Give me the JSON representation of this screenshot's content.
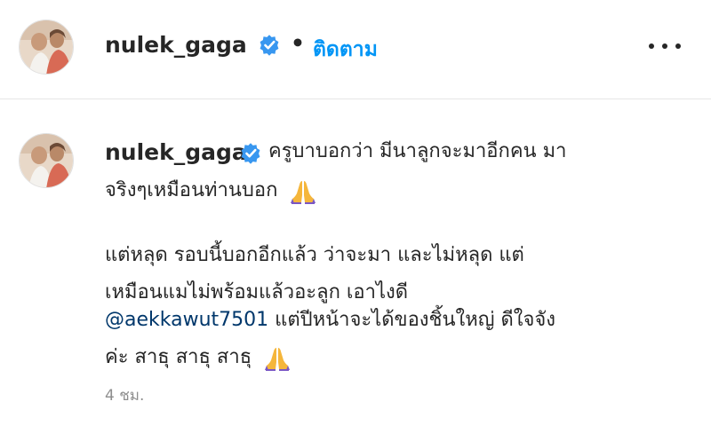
{
  "header": {
    "username": "nulek_gaga",
    "separator": "•",
    "follow_label": "ติดตาม",
    "more_icon": "more-horizontal-icon"
  },
  "comment": {
    "username": "nulek_gaga",
    "line1": "ครูบาบอกว่า มีนาลูกจะมาอีกคน มา",
    "line2": "จริงๆเหมือนท่านบอก",
    "line3": "แต่หลุด รอบนี้บอกอีกแล้ว ว่าจะมา และไม่หลุด แต่",
    "line4": "เหมือนแมไม่พร้อมแล้วอะลูก เอาไงดี",
    "mention": "@aekkawut7501",
    "line5_rest": " แต่ปีหน้าจะได้ของชิ้นใหญ่ ดีใจจัง",
    "line6": "ค่ะ สาธุ สาธุ สาธุ",
    "emoji": "folded-hands-icon",
    "timestamp": "4 ชม."
  },
  "colors": {
    "link": "#0095f6",
    "mention": "#00376b",
    "verified": "#3897f0",
    "muted": "#8e8e8e"
  }
}
